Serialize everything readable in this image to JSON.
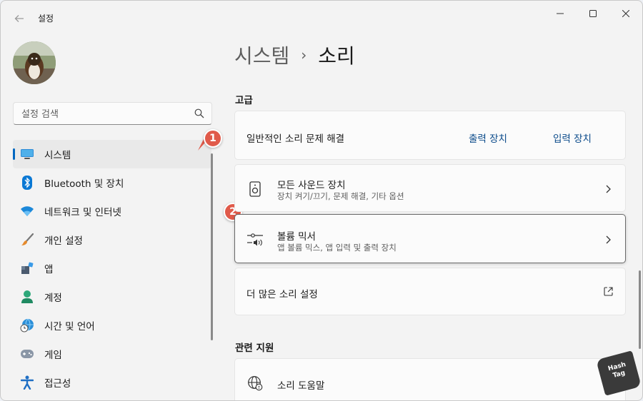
{
  "window": {
    "title": "설정",
    "controls": [
      "minimize-icon",
      "maximize-icon",
      "close-icon"
    ]
  },
  "sidebar": {
    "search_placeholder": "설정 검색",
    "items": [
      {
        "label": "시스템",
        "icon": "system-monitor-icon",
        "selected": true
      },
      {
        "label": "Bluetooth 및 장치",
        "icon": "bluetooth-icon"
      },
      {
        "label": "네트워크 및 인터넷",
        "icon": "wifi-icon"
      },
      {
        "label": "개인 설정",
        "icon": "paintbrush-icon"
      },
      {
        "label": "앱",
        "icon": "apps-icon"
      },
      {
        "label": "계정",
        "icon": "account-icon"
      },
      {
        "label": "시간 및 언어",
        "icon": "globe-clock-icon"
      },
      {
        "label": "게임",
        "icon": "gamepad-icon"
      },
      {
        "label": "접근성",
        "icon": "accessibility-icon"
      }
    ]
  },
  "main": {
    "breadcrumb": {
      "parent": "시스템",
      "separator": "›",
      "current": "소리"
    },
    "section_advanced": "고급",
    "troubleshoot": {
      "label": "일반적인 소리 문제 해결",
      "link_output": "출력 장치",
      "link_input": "입력 장치"
    },
    "all_devices": {
      "title": "모든 사운드 장치",
      "subtitle": "장치 켜기/끄기, 문제 해결, 기타 옵션"
    },
    "volume_mixer": {
      "title": "볼륨 믹서",
      "subtitle": "앱 볼륨 믹스, 앱 입력 및 출력 장치"
    },
    "more_settings": {
      "title": "더 많은 소리 설정"
    },
    "section_support": "관련 지원",
    "sound_help": {
      "title": "소리 도움말"
    }
  },
  "annotations": {
    "badge1": "1",
    "badge2": "2"
  },
  "watermark": {
    "line1": "Hash",
    "line2": "Tag"
  },
  "colors": {
    "accent": "#0067c0",
    "badge": "#e05a4a",
    "link": "#0a4a8a"
  }
}
